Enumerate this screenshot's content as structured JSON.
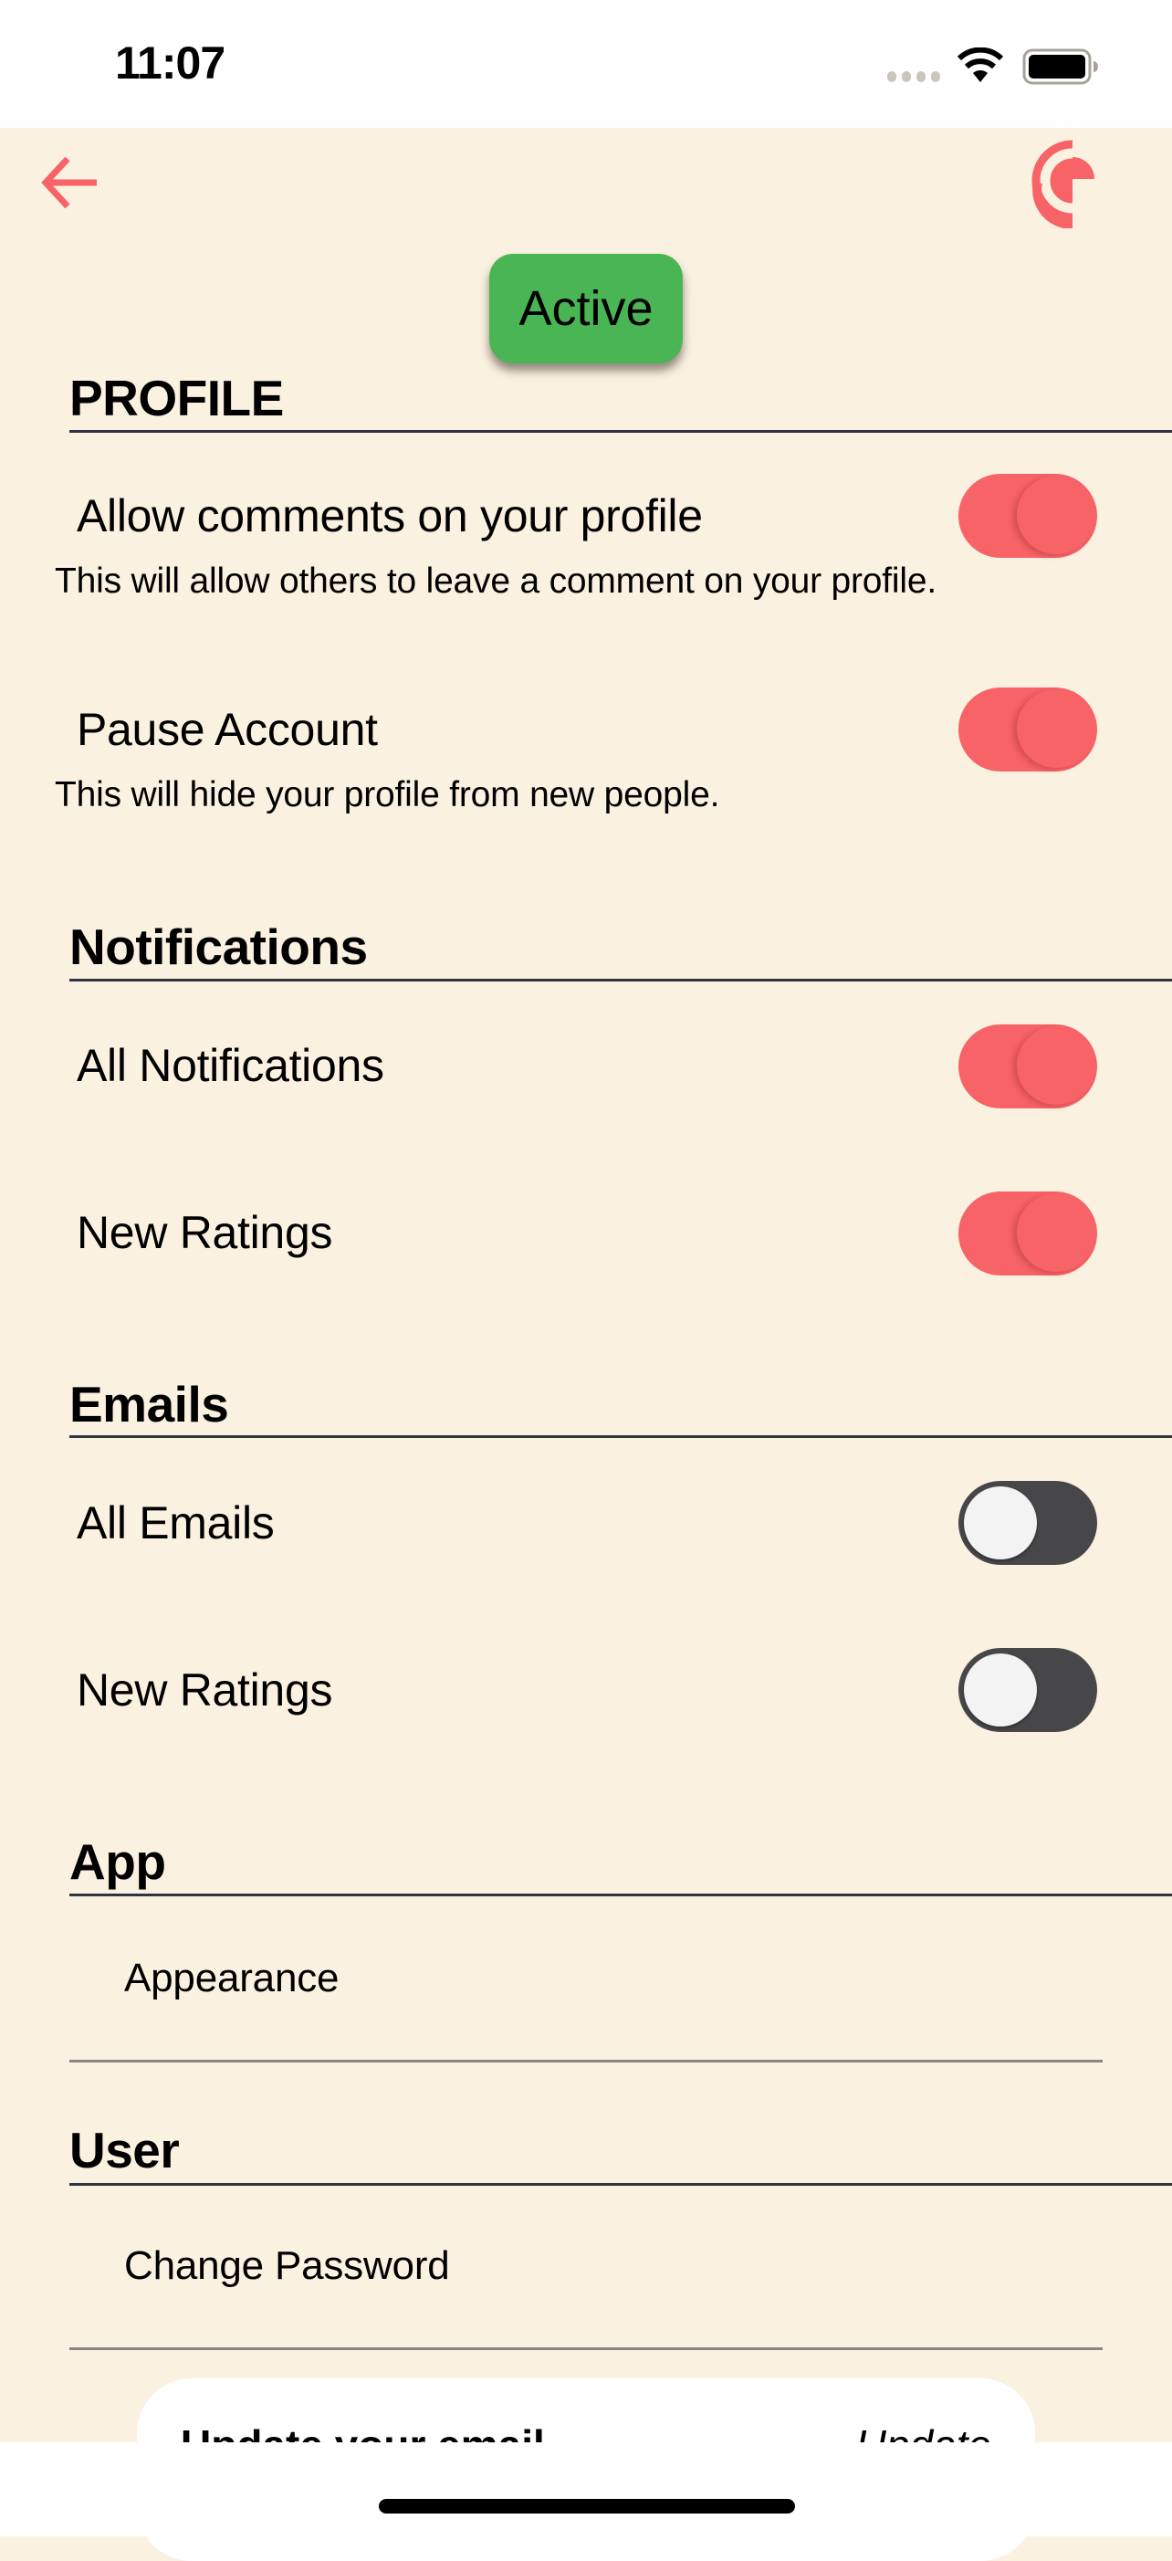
{
  "status_bar": {
    "time": "11:07",
    "icons": [
      "cellular-signal-icon",
      "wifi-icon",
      "battery-icon"
    ]
  },
  "header": {
    "back_icon": "arrow-left-icon",
    "logo_icon": "app-logo-icon",
    "status_badge": "Active"
  },
  "colors": {
    "background": "#fbf1e1",
    "accent": "#f76367",
    "badge_green": "#4ab554",
    "rule": "#2c3541",
    "divider": "#8a8583",
    "toggle_off": "#474749"
  },
  "sections": {
    "profile": {
      "title": "PROFILE",
      "items": [
        {
          "label": "Allow comments on your profile",
          "description": "This will allow others to leave a comment on your profile.",
          "enabled": true
        },
        {
          "label": "Pause Account",
          "description": "This will hide your profile from new people.",
          "enabled": true
        }
      ]
    },
    "notifications": {
      "title": "Notifications",
      "items": [
        {
          "label": "All Notifications",
          "enabled": true
        },
        {
          "label": "New Ratings",
          "enabled": true
        }
      ]
    },
    "emails": {
      "title": "Emails",
      "items": [
        {
          "label": "All Emails",
          "enabled": false
        },
        {
          "label": "New Ratings",
          "enabled": false
        }
      ]
    },
    "app": {
      "title": "App",
      "items": [
        {
          "label": "Appearance"
        }
      ]
    },
    "user": {
      "title": "User",
      "items": [
        {
          "label": "Change Password"
        }
      ]
    }
  },
  "bottom_card": {
    "title": "Update your email",
    "action": "Update"
  }
}
